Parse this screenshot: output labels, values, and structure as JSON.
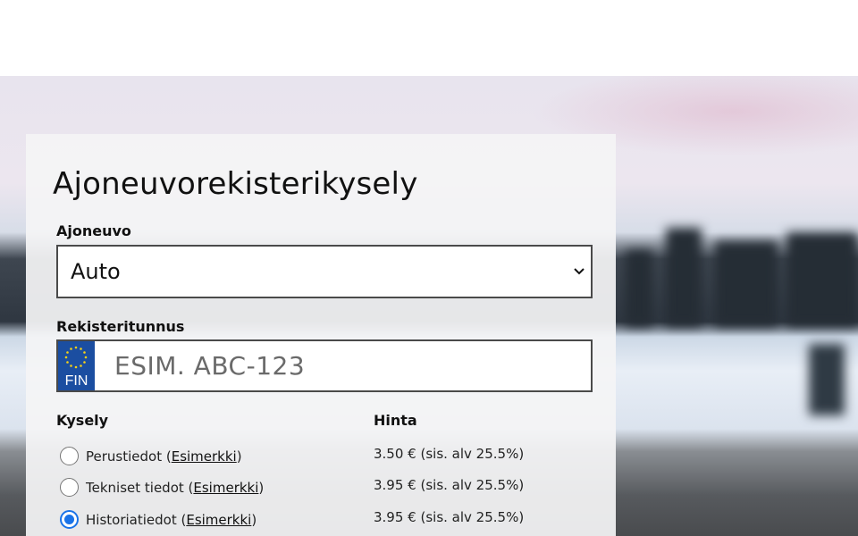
{
  "form": {
    "title": "Ajoneuvorekisterikysely",
    "vehicle_label": "Ajoneuvo",
    "vehicle_selected": "Auto",
    "reg_label": "Rekisteritunnus",
    "country_code": "FIN",
    "reg_placeholder": "ESIM. ABC-123",
    "query_header": "Kysely",
    "price_header": "Hinta",
    "example_link": "Esimerkki",
    "options": [
      {
        "label": "Perustiedot",
        "price": "3.50 € (sis. alv 25.5%)",
        "checked": false
      },
      {
        "label": "Tekniset tiedot",
        "price": "3.95 € (sis. alv 25.5%)",
        "checked": false
      },
      {
        "label": "Historiatiedot",
        "price": "3.95 € (sis. alv 25.5%)",
        "checked": true
      }
    ]
  },
  "icons": {
    "select_arrow": "chevron-down-icon",
    "flag": "eu-flag-icon"
  },
  "colors": {
    "plate_blue": "#1b4ea1",
    "radio_selected": "#1a73e8"
  }
}
